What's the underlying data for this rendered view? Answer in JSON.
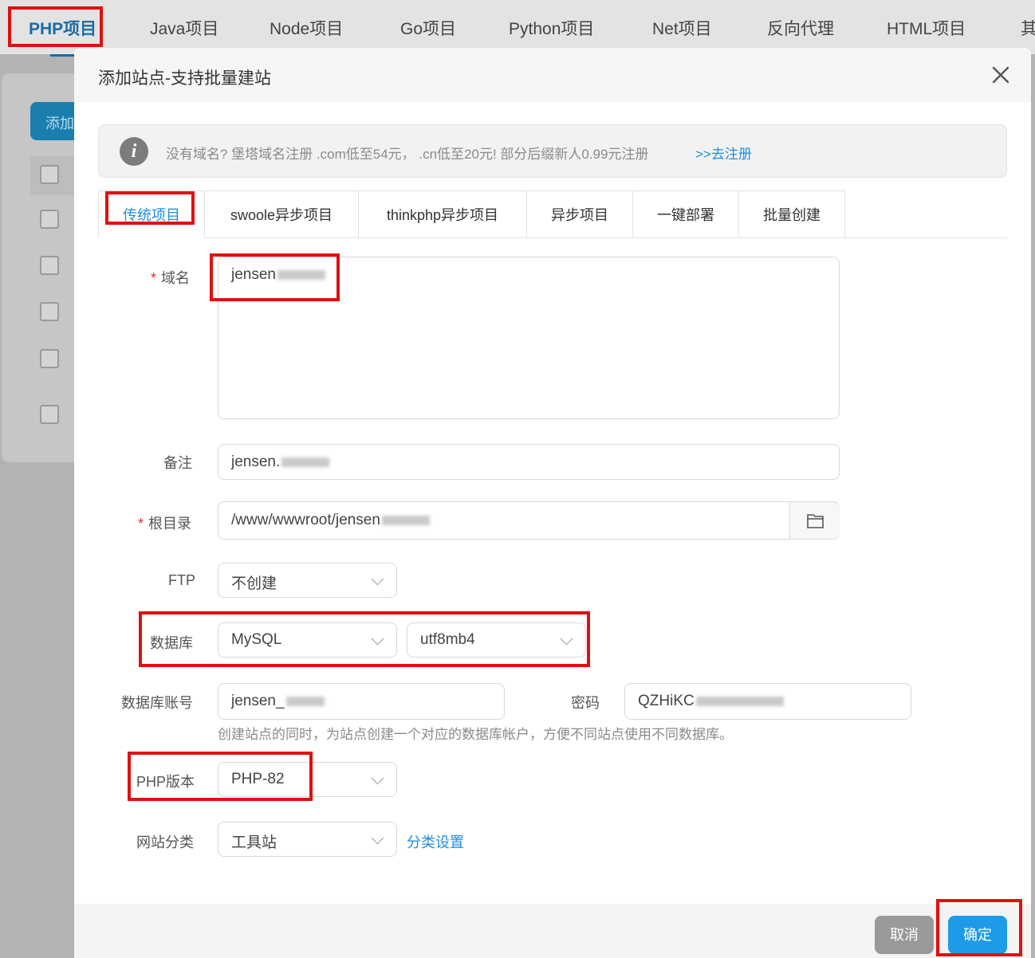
{
  "colors": {
    "accent": "#1f8ee0",
    "highlight": "#e01010",
    "confirm": "#1d9be6",
    "cancel": "#9a9a9a",
    "required": "#e0312f"
  },
  "topnav": {
    "tabs": [
      "PHP项目",
      "Java项目",
      "Node项目",
      "Go项目",
      "Python项目",
      "Net项目",
      "反向代理",
      "HTML项目",
      "其"
    ],
    "active_index": 0
  },
  "background": {
    "add_button": "添加"
  },
  "modal": {
    "title": "添加站点-支持批量建站",
    "close_icon": "close-icon",
    "notice": {
      "icon": "info-icon",
      "text": "没有域名? 堡塔域名注册 .com低至54元， .cn低至20元! 部分后缀新人0.99元注册",
      "link": ">>去注册"
    },
    "tabs": [
      "传统项目",
      "swoole异步项目",
      "thinkphp异步项目",
      "异步项目",
      "一键部署",
      "批量创建"
    ],
    "form": {
      "domain": {
        "label": "域名",
        "value": "jensen"
      },
      "remark": {
        "label": "备注",
        "value": "jensen."
      },
      "root": {
        "label": "根目录",
        "value": "/www/wwwroot/jensen",
        "icon": "folder-icon"
      },
      "ftp": {
        "label": "FTP",
        "value": "不创建"
      },
      "database": {
        "label": "数据库",
        "type": "MySQL",
        "charset": "utf8mb4"
      },
      "db_account": {
        "label": "数据库账号",
        "value": "jensen_",
        "password_label": "密码",
        "password_value": "QZHiKC"
      },
      "db_hint": "创建站点的同时，为站点创建一个对应的数据库帐户，方便不同站点使用不同数据库。",
      "php_version": {
        "label": "PHP版本",
        "value": "PHP-82"
      },
      "category": {
        "label": "网站分类",
        "value": "工具站",
        "link": "分类设置"
      }
    },
    "footer": {
      "cancel": "取消",
      "confirm": "确定"
    }
  }
}
